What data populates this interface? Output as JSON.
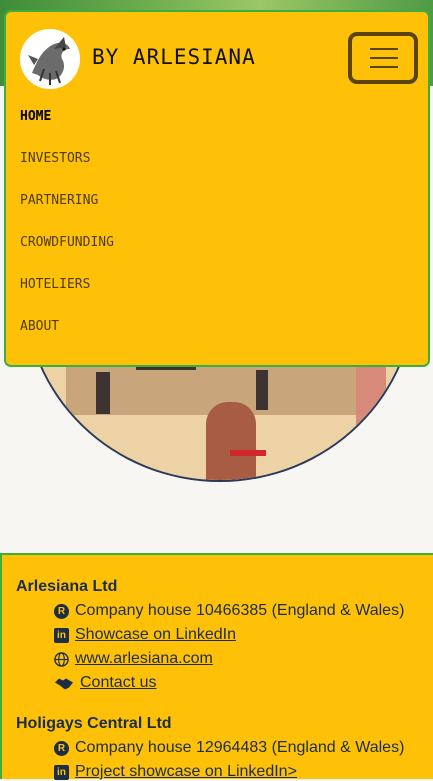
{
  "header": {
    "brand": "BY ARLESIANA",
    "logo_icon": "dragon-logo",
    "menu_icon": "hamburger-icon"
  },
  "menu": {
    "items": [
      {
        "label": "HOME",
        "active": true
      },
      {
        "label": "INVESTORS",
        "active": false
      },
      {
        "label": "PARTNERING",
        "active": false
      },
      {
        "label": "CROWDFUNDING",
        "active": false
      },
      {
        "label": "HOTELIERS",
        "active": false
      },
      {
        "label": "ABOUT",
        "active": false
      }
    ]
  },
  "hero": {
    "image": "hands-holding-cardboard-box"
  },
  "footer": {
    "companies": [
      {
        "name": "Arlesiana Ltd",
        "lines": [
          {
            "icon": "registered-icon",
            "text": "Company house 10466385 (England & Wales)",
            "link": false
          },
          {
            "icon": "linkedin-icon",
            "text": " Showcase on LinkedIn",
            "link": true
          },
          {
            "icon": "globe-icon",
            "text": " www.arlesiana.com",
            "link": true
          },
          {
            "icon": "handshake-icon",
            "text": " Contact us",
            "link": true
          }
        ]
      },
      {
        "name": "Holigays Central Ltd",
        "lines": [
          {
            "icon": "registered-icon",
            "text": "Company house 12964483 (England & Wales)",
            "link": false
          },
          {
            "icon": "linkedin-icon",
            "text": " Project showcase on LinkedIn>",
            "link": true
          }
        ]
      }
    ]
  },
  "colors": {
    "nav_bg": "#fec107",
    "border_green": "#3cae3c",
    "text_dark": "#1d2e44"
  }
}
